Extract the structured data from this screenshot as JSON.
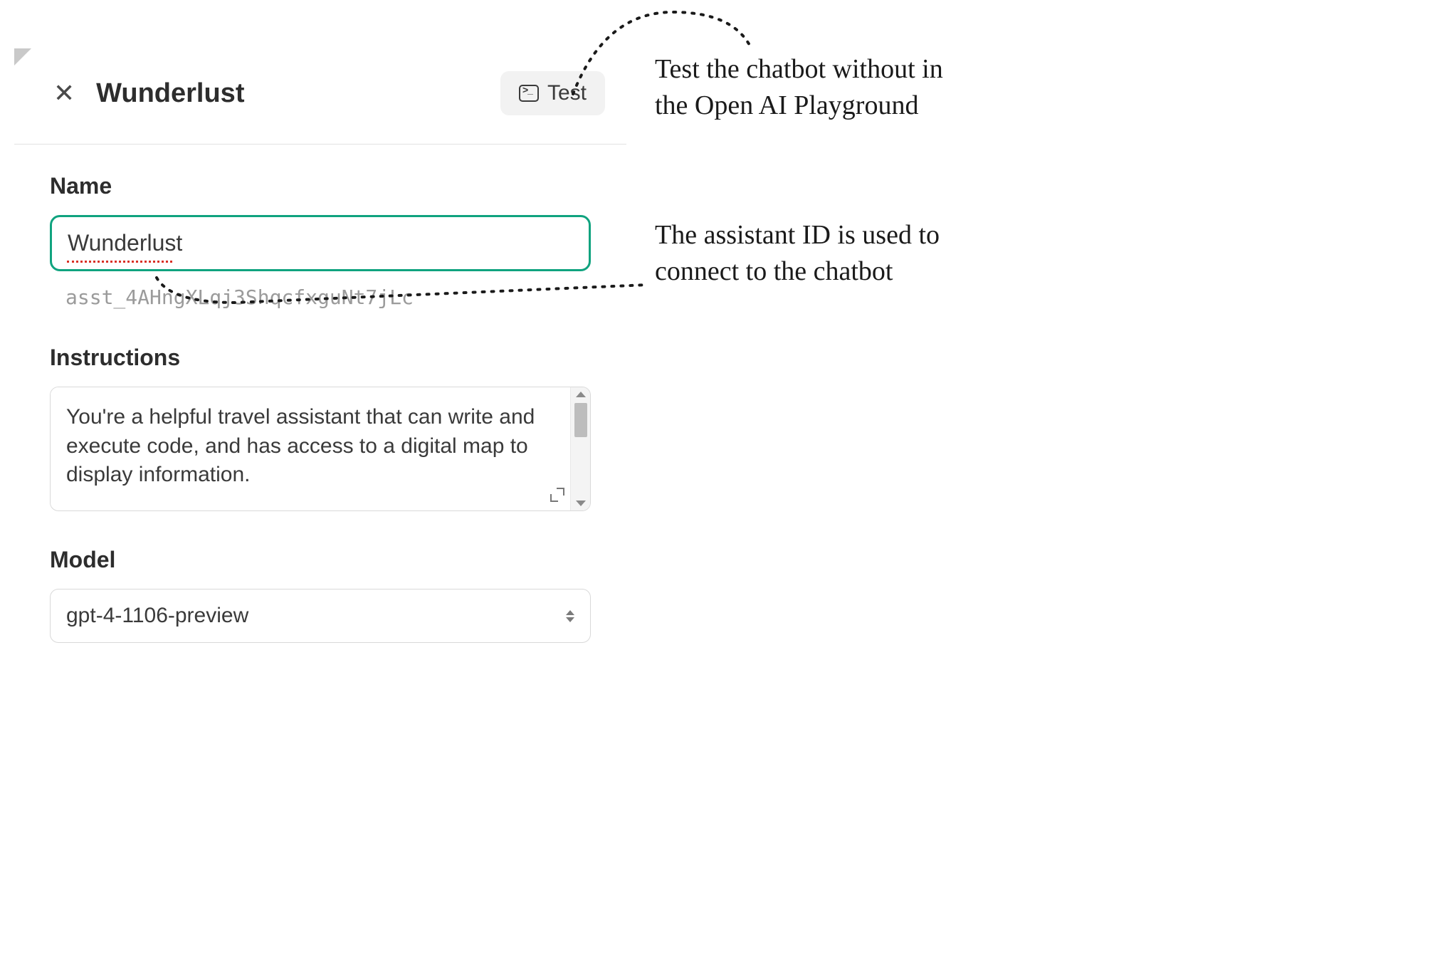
{
  "header": {
    "title": "Wunderlust",
    "test_label": "Test"
  },
  "form": {
    "name_label": "Name",
    "name_value": "Wunderlust",
    "assistant_id": "asst_4AHngXLqj3ShqcfxguNt7jLc",
    "instructions_label": "Instructions",
    "instructions_value": "You're a helpful travel assistant that can write and execute code, and has access to a digital map to display information.",
    "model_label": "Model",
    "model_value": "gpt-4-1106-preview"
  },
  "annotations": {
    "test": "Test the chatbot without in the Open AI Playground",
    "id": "The assistant ID is used to connect to the chatbot"
  }
}
